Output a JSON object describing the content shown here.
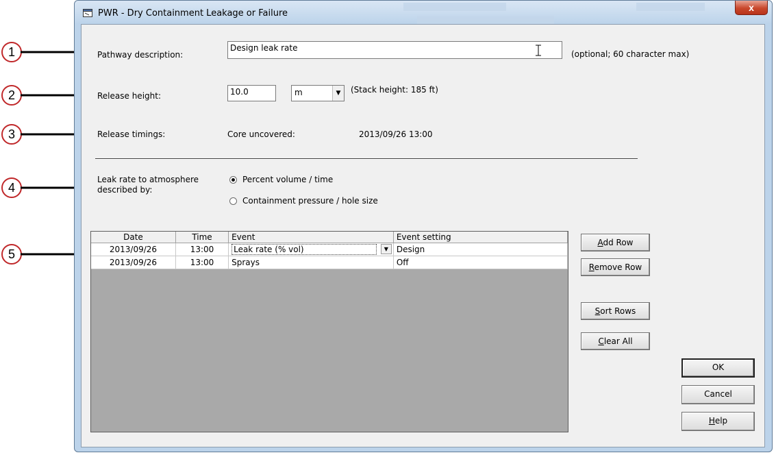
{
  "window": {
    "title": "PWR - Dry Containment Leakage or Failure",
    "close_label": "x"
  },
  "callouts": [
    "1",
    "2",
    "3",
    "4",
    "5"
  ],
  "pathway": {
    "label": "Pathway description:",
    "value": "Design leak rate",
    "note": "(optional; 60 character max)"
  },
  "release_height": {
    "label": "Release height:",
    "value": "10.0",
    "unit": "m",
    "note": "(Stack height: 185 ft)"
  },
  "release_timings": {
    "label": "Release timings:",
    "event": "Core uncovered:",
    "time": "2013/09/26 13:00"
  },
  "leak_rate": {
    "label_line1": "Leak rate to atmosphere",
    "label_line2": "described by:",
    "options": [
      "Percent volume / time",
      "Containment pressure / hole size"
    ],
    "selected": 0
  },
  "grid": {
    "columns": [
      "Date",
      "Time",
      "Event",
      "Event setting"
    ],
    "rows": [
      [
        "2013/09/26",
        "13:00",
        "Leak rate (% vol)",
        "Design"
      ],
      [
        "2013/09/26",
        "13:00",
        "Sprays",
        "Off"
      ]
    ]
  },
  "buttons": {
    "add_row": {
      "pre": "",
      "u": "A",
      "post": "dd Row"
    },
    "remove_row": {
      "pre": "",
      "u": "R",
      "post": "emove Row"
    },
    "sort_rows": {
      "pre": "",
      "u": "S",
      "post": "ort Rows"
    },
    "clear_all": {
      "pre": "",
      "u": "C",
      "post": "lear All"
    },
    "ok": "OK",
    "cancel": "Cancel",
    "help": {
      "pre": "",
      "u": "H",
      "post": "elp"
    }
  },
  "colors": {
    "callout_ring": "#c0282a",
    "window_frame": "#bcd3ea",
    "dialog_bg": "#f0f0f0",
    "grid_empty": "#a9a9a9"
  }
}
